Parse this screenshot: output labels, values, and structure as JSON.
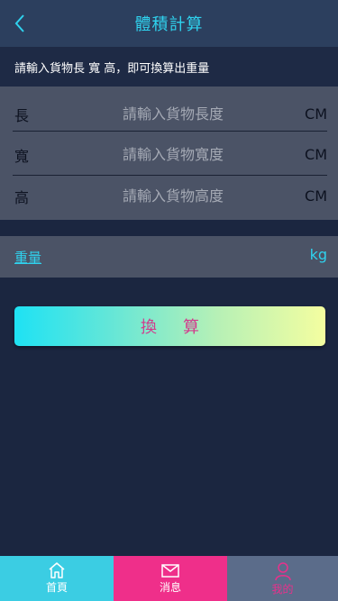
{
  "header": {
    "title": "體積計算",
    "back_icon": "chevron-left-icon"
  },
  "instruction": "請輸入貨物長 寬 高，即可換算出重量",
  "dimensions": [
    {
      "label": "長",
      "placeholder": "請輸入貨物長度",
      "value": "",
      "unit": "CM"
    },
    {
      "label": "寬",
      "placeholder": "請輸入貨物寬度",
      "value": "",
      "unit": "CM"
    },
    {
      "label": "高",
      "placeholder": "請輸入貨物高度",
      "value": "",
      "unit": "CM"
    }
  ],
  "weight": {
    "label": "重量",
    "unit": "kg"
  },
  "convert_button": "換 算",
  "tabbar": [
    {
      "label": "首頁",
      "icon": "home-icon"
    },
    {
      "label": "消息",
      "icon": "mail-icon"
    },
    {
      "label": "我的",
      "icon": "user-icon"
    }
  ],
  "colors": {
    "accent": "#2fd2ee",
    "background": "#1b2640",
    "header": "#2c3f5e",
    "panel": "#4b5366",
    "tab_home": "#3bcde3",
    "tab_messages": "#ef2f8a",
    "tab_me": "#5b6c8a",
    "button_text": "#d23a8c"
  }
}
